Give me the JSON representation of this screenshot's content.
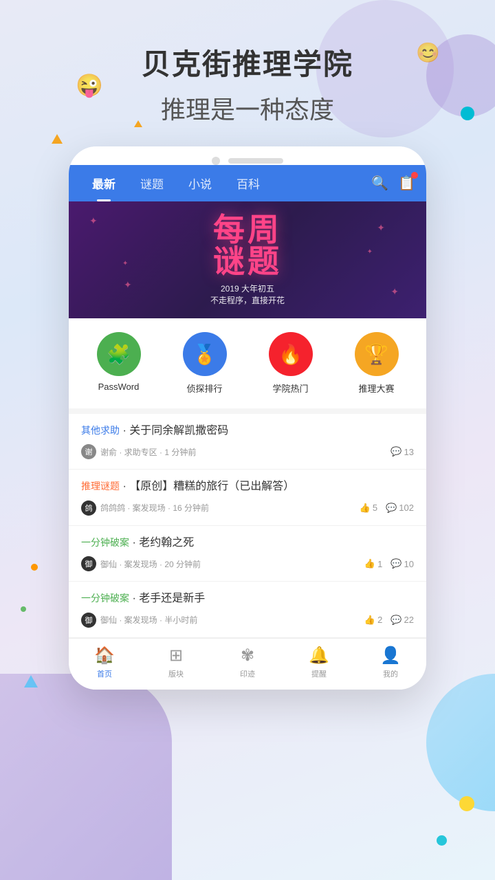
{
  "header": {
    "title": "贝克街推理学院",
    "subtitle": "推理是一种态度"
  },
  "nav": {
    "tabs": [
      {
        "label": "最新",
        "active": true
      },
      {
        "label": "谜题",
        "active": false
      },
      {
        "label": "小说",
        "active": false
      },
      {
        "label": "百科",
        "active": false
      }
    ]
  },
  "banner": {
    "text_main": "每周\n谜题",
    "sub_line1": "2019 大年初五",
    "sub_line2": "不走程序，直接开花"
  },
  "quick_icons": [
    {
      "label": "PassWord",
      "icon": "🧩",
      "color_class": "icon-green"
    },
    {
      "label": "侦探排行",
      "icon": "🏅",
      "color_class": "icon-blue"
    },
    {
      "label": "学院热门",
      "icon": "🔥",
      "color_class": "icon-red"
    },
    {
      "label": "推理大赛",
      "icon": "🏆",
      "color_class": "icon-gold"
    }
  ],
  "feed": [
    {
      "category": "其他求助",
      "category_color": "blue",
      "title": "关于同余解凯撒密码",
      "author": "谢俞",
      "section": "求助专区",
      "time": "1 分钟前",
      "likes": null,
      "comments": "13"
    },
    {
      "category": "推理谜题",
      "category_color": "orange",
      "title": "【原创】糟糕的旅行（已出解答）",
      "author": "鸽鸽鸽",
      "section": "案发现场",
      "time": "16 分钟前",
      "likes": "5",
      "comments": "102"
    },
    {
      "category": "一分钟破案",
      "category_color": "green",
      "title": "老约翰之死",
      "author": "御仙",
      "section": "案发现场",
      "time": "20 分钟前",
      "likes": "1",
      "comments": "10"
    },
    {
      "category": "一分钟破案",
      "category_color": "green",
      "title": "老手还是新手",
      "author": "御仙",
      "section": "案发现场",
      "time": "半小时前",
      "likes": "2",
      "comments": "22"
    }
  ],
  "bottom_nav": [
    {
      "label": "首页",
      "active": true,
      "icon": "home"
    },
    {
      "label": "版块",
      "active": false,
      "icon": "grid"
    },
    {
      "label": "印迹",
      "active": false,
      "icon": "footprint"
    },
    {
      "label": "提醒",
      "active": false,
      "icon": "bell"
    },
    {
      "label": "我的",
      "active": false,
      "icon": "person"
    }
  ]
}
